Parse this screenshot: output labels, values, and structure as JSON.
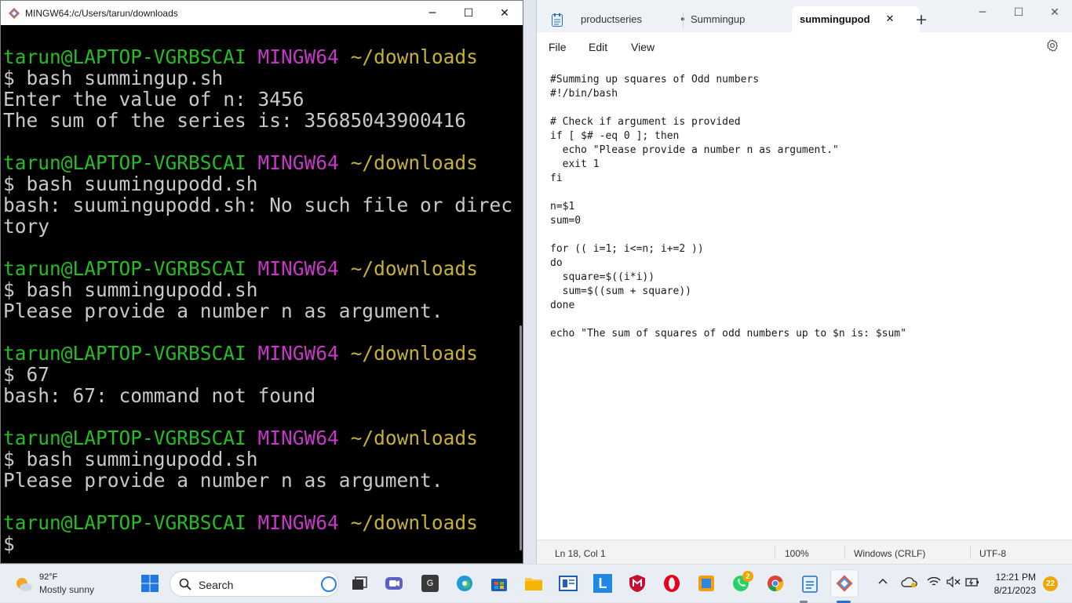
{
  "terminal": {
    "title": "MINGW64:/c/Users/tarun/downloads",
    "controls": {
      "minimize": "─",
      "maximize": "☐",
      "close": "✕"
    },
    "prompt_user": "tarun@LAPTOP-VGRBSCAI",
    "prompt_env": "MINGW64",
    "prompt_path": "~/downloads",
    "lines": [
      {
        "type": "prompt"
      },
      {
        "type": "text",
        "text": "$ bash summingup.sh"
      },
      {
        "type": "text",
        "text": "Enter the value of n: 3456"
      },
      {
        "type": "text",
        "text": "The sum of the series is: 35685043900416"
      },
      {
        "type": "blank"
      },
      {
        "type": "prompt"
      },
      {
        "type": "text",
        "text": "$ bash suumingupodd.sh"
      },
      {
        "type": "text",
        "text": "bash: suumingupodd.sh: No such file or direc"
      },
      {
        "type": "text",
        "text": "tory"
      },
      {
        "type": "blank"
      },
      {
        "type": "prompt"
      },
      {
        "type": "text",
        "text": "$ bash summingupodd.sh"
      },
      {
        "type": "text",
        "text": "Please provide a number n as argument."
      },
      {
        "type": "blank"
      },
      {
        "type": "prompt"
      },
      {
        "type": "text",
        "text": "$ 67"
      },
      {
        "type": "text",
        "text": "bash: 67: command not found"
      },
      {
        "type": "blank"
      },
      {
        "type": "prompt"
      },
      {
        "type": "text",
        "text": "$ bash summingupodd.sh"
      },
      {
        "type": "text",
        "text": "Please provide a number n as argument."
      },
      {
        "type": "blank"
      },
      {
        "type": "prompt"
      },
      {
        "type": "text",
        "text": "$"
      }
    ],
    "colors": {
      "user": "#25bc24",
      "env": "#c837c8",
      "path": "#c7b132",
      "text": "#c8c8c8",
      "background": "#000000"
    }
  },
  "notepad": {
    "tabs": [
      {
        "label": "productseries",
        "modified_dot": "●"
      },
      {
        "label": "Summingup"
      },
      {
        "label": "summingupod",
        "close": "✕",
        "active": true
      }
    ],
    "new_tab": "+",
    "controls": {
      "minimize": "─",
      "maximize": "☐",
      "close": "✕"
    },
    "menu": [
      "File",
      "Edit",
      "View"
    ],
    "code": [
      "#Summing up squares of Odd numbers",
      "#!/bin/bash",
      "",
      "# Check if argument is provided",
      "if [ $# -eq 0 ]; then",
      "  echo \"Please provide a number n as argument.\"",
      "  exit 1",
      "fi",
      "",
      "n=$1",
      "sum=0",
      "",
      "for (( i=1; i<=n; i+=2 ))",
      "do",
      "  square=$((i*i))",
      "  sum=$((sum + square))",
      "done",
      "",
      "echo \"The sum of squares of odd numbers up to $n is: $sum\""
    ],
    "status": {
      "position": "Ln 18, Col 1",
      "zoom": "100%",
      "line_ending": "Windows (CRLF)",
      "encoding": "UTF-8"
    }
  },
  "taskbar": {
    "weather": {
      "temp": "92°F",
      "condition": "Mostly sunny"
    },
    "search_label": "Search",
    "apps": [
      "start-icon",
      "search-icon",
      "task-view-icon",
      "teams-meet-icon",
      "app-g-icon",
      "edge-icon",
      "store-icon",
      "file-explorer-icon",
      "app-frame-icon",
      "app-l-icon",
      "mcafee-icon",
      "opera-icon",
      "app-box-icon",
      "whatsapp-icon",
      "chrome-icon",
      "notepad-icon",
      "git-bash-icon"
    ],
    "whatsapp_badge": "2",
    "notification_badge": "22",
    "time": "12:21 PM",
    "date": "8/21/2023"
  }
}
